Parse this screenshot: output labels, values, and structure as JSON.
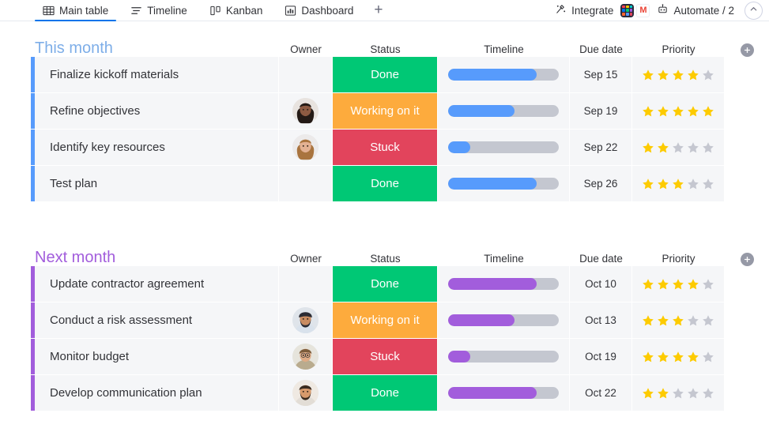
{
  "header": {
    "tabs": [
      {
        "label": "Main table",
        "icon": "table-icon",
        "active": true
      },
      {
        "label": "Timeline",
        "icon": "timeline-icon",
        "active": false
      },
      {
        "label": "Kanban",
        "icon": "kanban-icon",
        "active": false
      },
      {
        "label": "Dashboard",
        "icon": "dashboard-icon",
        "active": false
      }
    ],
    "add_tab_label": "+",
    "integrate_label": "Integrate",
    "automate_label": "Automate / 2",
    "app_icons": [
      "monday-app-icon",
      "gmail-icon"
    ],
    "collapse_icon": "chevron-up-icon"
  },
  "columns": {
    "owner": "Owner",
    "status": "Status",
    "timeline": "Timeline",
    "due_date": "Due date",
    "priority": "Priority",
    "add_column_icon": "plus-icon"
  },
  "colors": {
    "done": "#00c875",
    "working": "#fdab3d",
    "stuck": "#e2445c",
    "group_blue": "#7eaee8",
    "group_purple": "#a25ddc",
    "accent_blue": "#579bfc",
    "accent_purple": "#a25ddc",
    "bar_blue": "#579bfc",
    "bar_purple": "#a25ddc",
    "bar_track": "#c4c7d0",
    "star_on": "#fdcb00",
    "star_off": "#c5c7d0",
    "tab_active": "#0073ea"
  },
  "groups": [
    {
      "title": "This month",
      "color_key": "blue",
      "rows": [
        {
          "name": "Finalize kickoff materials",
          "owner": null,
          "status": "Done",
          "status_color": "#00c875",
          "progress": 80,
          "due": "Sep 15",
          "priority": 4
        },
        {
          "name": "Refine objectives",
          "owner": "avatar-woman-dark-hair",
          "status": "Working on it",
          "status_color": "#fdab3d",
          "progress": 60,
          "due": "Sep 19",
          "priority": 5
        },
        {
          "name": "Identify key resources",
          "owner": "avatar-woman-light-hair",
          "status": "Stuck",
          "status_color": "#e2445c",
          "progress": 20,
          "due": "Sep 22",
          "priority": 2
        },
        {
          "name": "Test plan",
          "owner": null,
          "status": "Done",
          "status_color": "#00c875",
          "progress": 80,
          "due": "Sep 26",
          "priority": 3
        }
      ]
    },
    {
      "title": "Next month",
      "color_key": "purple",
      "rows": [
        {
          "name": "Update contractor agreement",
          "owner": null,
          "status": "Done",
          "status_color": "#00c875",
          "progress": 80,
          "due": "Oct 10",
          "priority": 4
        },
        {
          "name": "Conduct a risk assessment",
          "owner": "avatar-man-beard-turban",
          "status": "Working on it",
          "status_color": "#fdab3d",
          "progress": 60,
          "due": "Oct 13",
          "priority": 3
        },
        {
          "name": "Monitor budget",
          "owner": "avatar-woman-glasses",
          "status": "Stuck",
          "status_color": "#e2445c",
          "progress": 20,
          "due": "Oct 19",
          "priority": 4
        },
        {
          "name": "Develop communication plan",
          "owner": "avatar-man-beard",
          "status": "Done",
          "status_color": "#00c875",
          "progress": 80,
          "due": "Oct 22",
          "priority": 2
        }
      ]
    }
  ]
}
